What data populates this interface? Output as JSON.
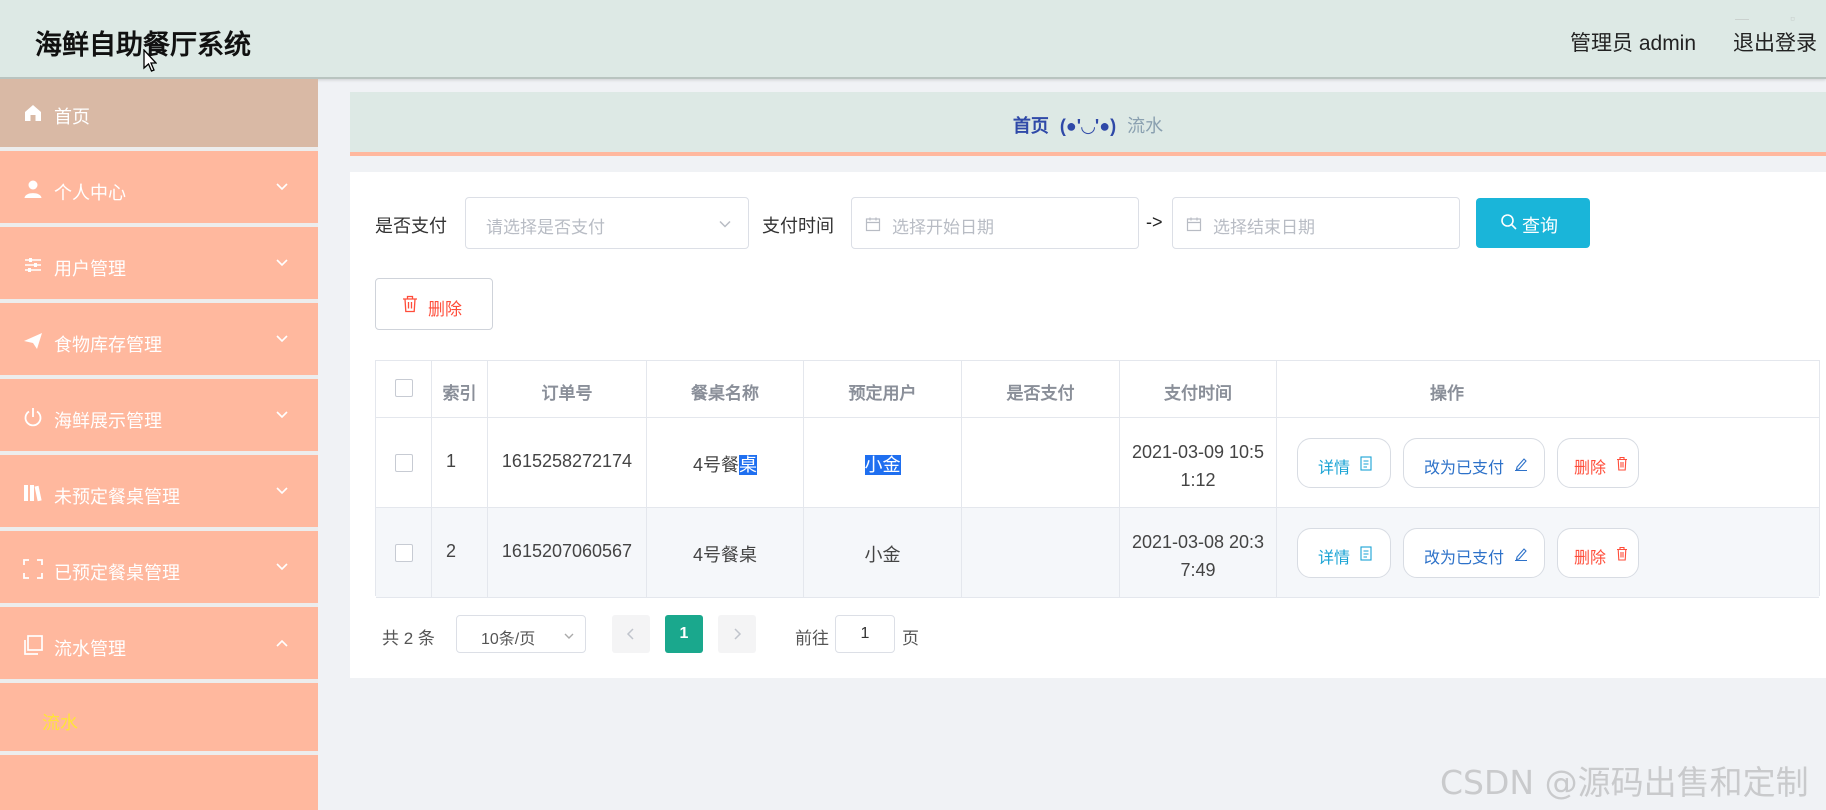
{
  "header": {
    "title": "海鲜自助餐厅系统",
    "user": "管理员 admin",
    "logout": "退出登录"
  },
  "sidebar": {
    "items": [
      {
        "label": "首页",
        "icon": "home-icon"
      },
      {
        "label": "个人中心",
        "icon": "user-icon"
      },
      {
        "label": "用户管理",
        "icon": "sliders-icon"
      },
      {
        "label": "食物库存管理",
        "icon": "send-icon"
      },
      {
        "label": "海鲜展示管理",
        "icon": "power-icon"
      },
      {
        "label": "未预定餐桌管理",
        "icon": "books-icon"
      },
      {
        "label": "已预定餐桌管理",
        "icon": "scan-icon"
      },
      {
        "label": "流水管理",
        "icon": "copy-icon"
      }
    ],
    "sub_items": [
      {
        "label": "流水"
      }
    ]
  },
  "breadcrumb": {
    "home": "首页",
    "separator": "(●'◡'●)",
    "current": "流水"
  },
  "filters": {
    "paid_label": "是否支付",
    "paid_placeholder": "请选择是否支付",
    "time_label": "支付时间",
    "start_placeholder": "选择开始日期",
    "arrow": "->",
    "end_placeholder": "选择结束日期",
    "query_button": "查询"
  },
  "toolbar": {
    "delete_button": "删除"
  },
  "table": {
    "columns": [
      "索引",
      "订单号",
      "餐桌名称",
      "预定用户",
      "是否支付",
      "支付时间",
      "操作"
    ],
    "rows": [
      {
        "index": "1",
        "order_no": "1615258272174",
        "table_name_a": "4号餐",
        "table_name_b": "桌",
        "user": "小金",
        "paid": "",
        "time_line1": "2021-03-09 10:5",
        "time_line2": "1:12",
        "detail": "详情",
        "mark_paid": "改为已支付",
        "remove": "删除"
      },
      {
        "index": "2",
        "order_no": "1615207060567",
        "table_name": "4号餐桌",
        "user": "小金",
        "paid": "",
        "time_line1": "2021-03-08 20:3",
        "time_line2": "7:49",
        "detail": "详情",
        "mark_paid": "改为已支付",
        "remove": "删除"
      }
    ]
  },
  "pagination": {
    "total": "共 2 条",
    "page_size": "10条/页",
    "current_page": "1",
    "goto_label": "前往",
    "goto_value": "1",
    "page_suffix": "页"
  },
  "watermark": "CSDN @源码出售和定制",
  "colors": {
    "header_bg": "#dde9e5",
    "sidebar_bg": "#ffb89e",
    "accent_query": "#1ab5d9",
    "page_active": "#1aa88d",
    "danger": "#ff4d3a"
  }
}
